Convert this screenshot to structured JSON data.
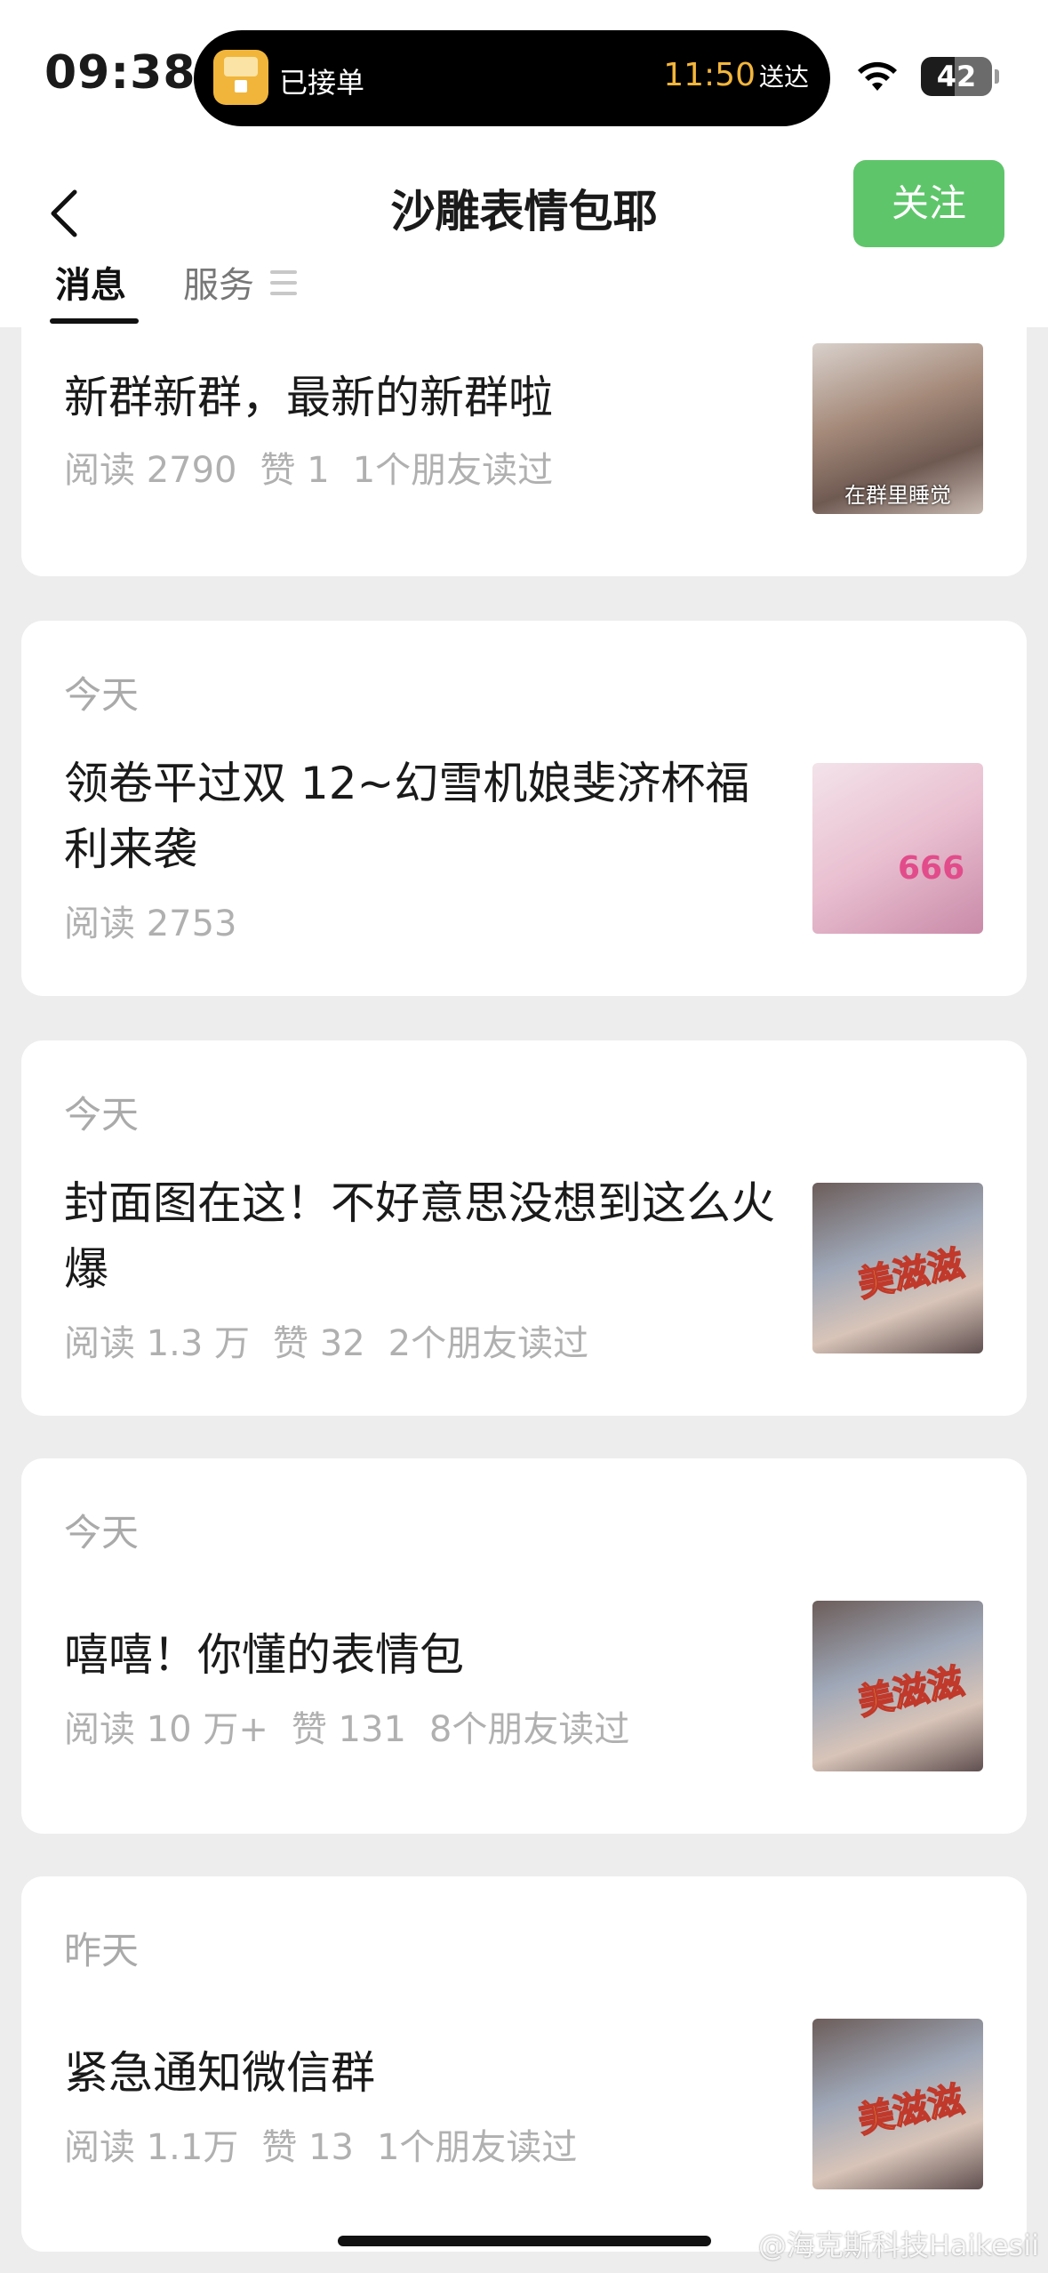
{
  "status": {
    "time": "09:38",
    "island_text": "已接单",
    "island_eta": "11:50",
    "island_eta_suffix": "送达",
    "battery": "42"
  },
  "nav": {
    "title": "沙雕表情包耶",
    "follow_label": "关注",
    "tabs": [
      "消息",
      "服务"
    ]
  },
  "articles": [
    {
      "date": "",
      "title": "新群新群，最新的新群啦",
      "stats": [
        "阅读 2790",
        "赞 1",
        "1个朋友读过"
      ],
      "thumb_caption": "在群里睡觉"
    },
    {
      "date": "今天",
      "title": "领卷平过双 12~幻雪机娘斐济杯福利来袭",
      "stats": [
        "阅读 2753"
      ],
      "thumb_caption": "666"
    },
    {
      "date": "今天",
      "title": "封面图在这！不好意思没想到这么火爆",
      "stats": [
        "阅读 1.3 万",
        "赞 32",
        "2个朋友读过"
      ],
      "thumb_caption": "美滋滋"
    },
    {
      "date": "今天",
      "title": "嘻嘻！你懂的表情包",
      "stats": [
        "阅读 10 万+",
        "赞 131",
        "8个朋友读过"
      ],
      "thumb_caption": "美滋滋"
    },
    {
      "date": "昨天",
      "title": "紧急通知微信群",
      "stats": [
        "阅读 1.1万",
        "赞 13",
        "1个朋友读过"
      ],
      "thumb_caption": "美滋滋"
    }
  ],
  "watermark": "@海克斯科技Haikesii",
  "colors": {
    "follow_green": "#5fc56b",
    "eta_orange": "#f3b63b"
  }
}
